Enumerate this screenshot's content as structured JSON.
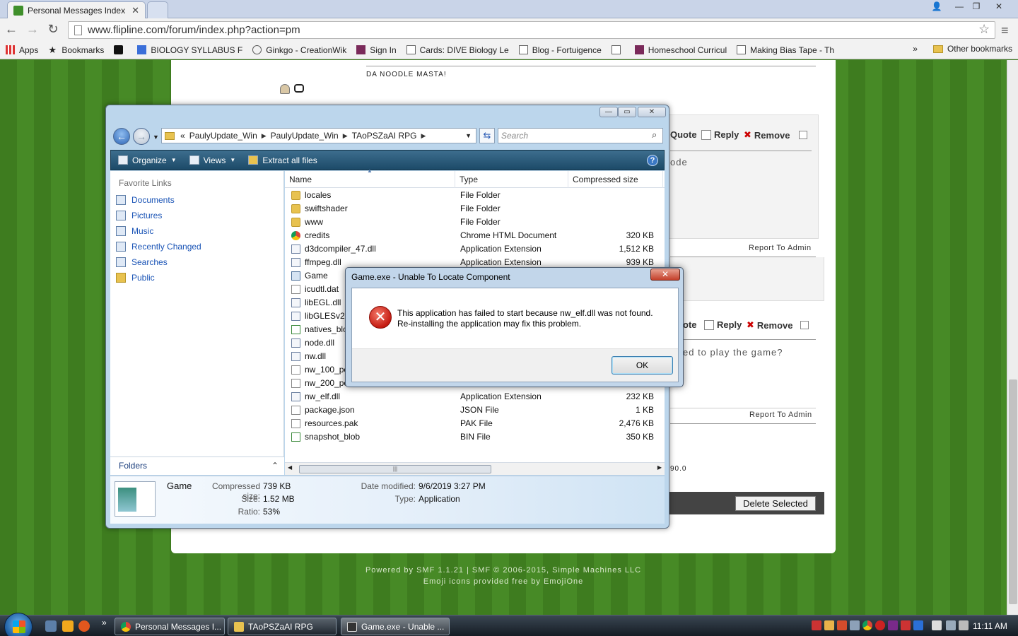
{
  "browser": {
    "tab_title": "Personal Messages Index",
    "url": "www.flipline.com/forum/index.php?action=pm",
    "bookmarks": [
      {
        "label": "Apps",
        "icon": "apps-grid-icon"
      },
      {
        "label": "Bookmarks",
        "icon": "star-icon"
      },
      {
        "label": "",
        "icon": "q-icon"
      },
      {
        "label": "BIOLOGY SYLLABUS F",
        "icon": "doc-icon"
      },
      {
        "label": "Ginkgo - CreationWik",
        "icon": "ginkgo-icon"
      },
      {
        "label": "Sign In",
        "icon": "grid-icon"
      },
      {
        "label": "Cards: DIVE Biology Le",
        "icon": "page-icon"
      },
      {
        "label": "Blog - Fortuigence",
        "icon": "page-icon"
      },
      {
        "label": "",
        "icon": "page-icon"
      },
      {
        "label": "Homeschool Curricul",
        "icon": "grid-icon"
      },
      {
        "label": "Making Bias Tape - Th",
        "icon": "page-icon"
      }
    ],
    "overflow": "»",
    "other_bookmarks": "Other bookmarks"
  },
  "forum": {
    "signature": "DA NOODLE MASTA!",
    "post1": {
      "quote": "Quote",
      "reply": "Reply",
      "remove": "Remove",
      "snippet": "ode",
      "report": "Report To Admin"
    },
    "post2": {
      "quote": "ote",
      "reply": "Reply",
      "remove": "Remove",
      "snippet": "ed to play the game?",
      "report": "Report To Admin"
    },
    "partial_text": "90.0",
    "delete_selected": "Delete Selected",
    "powered_by": "Powered by SMF 1.1.21 | SMF © 2006-2015, Simple Machines LLC",
    "emoji_credit": "Emoji icons provided free by EmojiOne"
  },
  "explorer": {
    "breadcrumbs": [
      "«",
      "PaulyUpdate_Win",
      "PaulyUpdate_Win",
      "TAoPSZaAI RPG"
    ],
    "search_placeholder": "Search",
    "commands": {
      "organize": "Organize",
      "views": "Views",
      "extract": "Extract all files"
    },
    "favorite_links_heading": "Favorite Links",
    "favorite_links": [
      "Documents",
      "Pictures",
      "Music",
      "Recently Changed",
      "Searches",
      "Public"
    ],
    "folders_label": "Folders",
    "columns": [
      "Name",
      "Type",
      "Compressed size"
    ],
    "files": [
      {
        "name": "locales",
        "type": "File Folder",
        "size": "",
        "icon": "folder"
      },
      {
        "name": "swiftshader",
        "type": "File Folder",
        "size": "",
        "icon": "folder"
      },
      {
        "name": "www",
        "type": "File Folder",
        "size": "",
        "icon": "folder"
      },
      {
        "name": "credits",
        "type": "Chrome HTML Document",
        "size": "320 KB",
        "icon": "chrome"
      },
      {
        "name": "d3dcompiler_47.dll",
        "type": "Application Extension",
        "size": "1,512 KB",
        "icon": "dll"
      },
      {
        "name": "ffmpeg.dll",
        "type": "Application Extension",
        "size": "939 KB",
        "icon": "dll"
      },
      {
        "name": "Game",
        "type": "",
        "size": "",
        "icon": "app"
      },
      {
        "name": "icudtl.dat",
        "type": "",
        "size": "",
        "icon": "file"
      },
      {
        "name": "libEGL.dll",
        "type": "",
        "size": "",
        "icon": "dll"
      },
      {
        "name": "libGLESv2.d",
        "type": "",
        "size": "",
        "icon": "dll"
      },
      {
        "name": "natives_blo",
        "type": "",
        "size": "",
        "icon": "blob"
      },
      {
        "name": "node.dll",
        "type": "",
        "size": "",
        "icon": "dll"
      },
      {
        "name": "nw.dll",
        "type": "",
        "size": "",
        "icon": "dll"
      },
      {
        "name": "nw_100_pe",
        "type": "",
        "size": "",
        "icon": "file"
      },
      {
        "name": "nw_200_pe",
        "type": "",
        "size": "",
        "icon": "file"
      },
      {
        "name": "nw_elf.dll",
        "type": "Application Extension",
        "size": "232 KB",
        "icon": "dll"
      },
      {
        "name": "package.json",
        "type": "JSON File",
        "size": "1 KB",
        "icon": "file"
      },
      {
        "name": "resources.pak",
        "type": "PAK File",
        "size": "2,476 KB",
        "icon": "file"
      },
      {
        "name": "snapshot_blob",
        "type": "BIN File",
        "size": "350 KB",
        "icon": "blob"
      }
    ],
    "details": {
      "name": "Game",
      "compressed_label": "Compressed size:",
      "compressed": "739 KB",
      "size_label": "Size:",
      "size": "1.52 MB",
      "ratio_label": "Ratio:",
      "ratio": "53%",
      "modified_label": "Date modified:",
      "modified": "9/6/2019 3:27 PM",
      "type_label": "Type:",
      "type": "Application"
    }
  },
  "dialog": {
    "title": "Game.exe - Unable To Locate Component",
    "line1": "This application has failed to start because nw_elf.dll was not found.",
    "line2": "Re-installing the application may fix this problem.",
    "ok": "OK"
  },
  "taskbar": {
    "tasks": [
      "Personal Messages I...",
      "TAoPSZaAI RPG",
      "Game.exe - Unable ..."
    ],
    "overflow": "»",
    "clock": "11:11 AM"
  },
  "colors": {
    "forum_green": "#3e7c1f",
    "explorer_cmd": "#1c4a68",
    "error_red": "#c51b12",
    "link_blue": "#1a54b6"
  }
}
